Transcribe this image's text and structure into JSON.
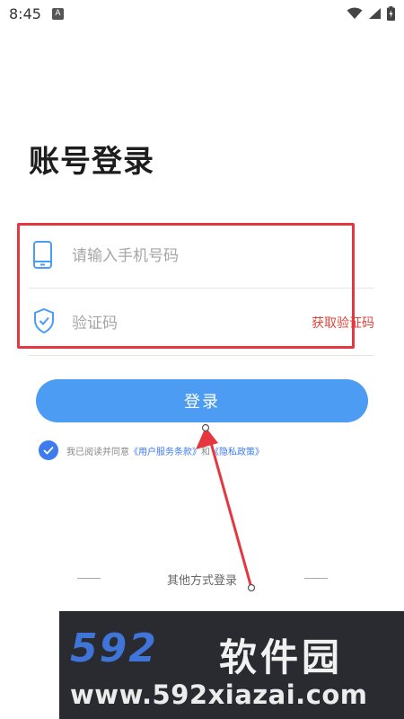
{
  "status_bar": {
    "time": "8:45",
    "app_badge": "A"
  },
  "page": {
    "title": "账号登录"
  },
  "phone_field": {
    "placeholder": "请输入手机号码",
    "value": ""
  },
  "code_field": {
    "placeholder": "验证码",
    "value": "",
    "get_code_label": "获取验证码"
  },
  "login_button": {
    "label": "登录"
  },
  "agreement": {
    "checked": true,
    "prefix": "我已阅读并同意",
    "terms_link": "《用户服务条款》",
    "connector": "和",
    "privacy_link": "《隐私政策》"
  },
  "other_login": {
    "label": "其他方式登录"
  },
  "watermark": {
    "brand_digits": "592",
    "brand_name": "软件园",
    "url": "www.592xiazai.com"
  },
  "colors": {
    "primary": "#4d9cf3",
    "accent_red": "#e0453a",
    "check_blue": "#3e7bf0",
    "highlight": "#e5373f"
  }
}
